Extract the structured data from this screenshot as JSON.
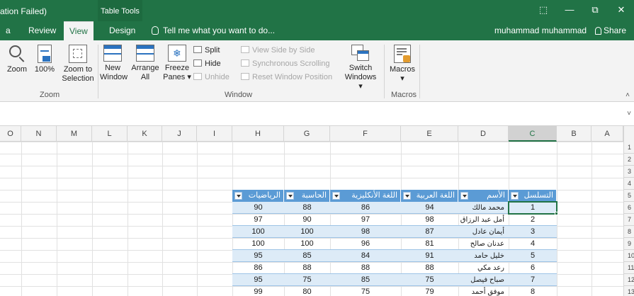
{
  "titlebar": {
    "window_title": "ation Failed)",
    "context_tab": "Table Tools",
    "buttons": {
      "restore_ribbon": "⬚",
      "minimize": "—",
      "maximize": "⧉",
      "close": "✕"
    }
  },
  "tabs": {
    "items": [
      {
        "label": "a"
      },
      {
        "label": "Review"
      },
      {
        "label": "View",
        "active": true
      },
      {
        "label": "Design"
      }
    ],
    "tell_me": "Tell me what you want to do...",
    "user": "muhammad muhammad",
    "share": "Share"
  },
  "ribbon": {
    "zoom_group": {
      "label": "Zoom",
      "zoom": "Zoom",
      "hundred": "100%",
      "zoom_to_selection_1": "Zoom to",
      "zoom_to_selection_2": "Selection"
    },
    "window_group": {
      "label": "Window",
      "new_window_1": "New",
      "new_window_2": "Window",
      "arrange_all_1": "Arrange",
      "arrange_all_2": "All",
      "freeze_panes_1": "Freeze",
      "freeze_panes_2": "Panes ▾",
      "split": "Split",
      "hide": "Hide",
      "unhide": "Unhide",
      "view_side_by_side": "View Side by Side",
      "synchronous_scrolling": "Synchronous Scrolling",
      "reset_window_position": "Reset Window Position",
      "switch_windows_1": "Switch",
      "switch_windows_2": "Windows ▾"
    },
    "macros_group": {
      "label": "Macros",
      "macros": "Macros",
      "macros_caret": "▾"
    },
    "collapse": "˄"
  },
  "formula_bar": {
    "expand": "˅"
  },
  "grid": {
    "columns": [
      "O",
      "N",
      "M",
      "L",
      "K",
      "J",
      "I",
      "H",
      "G",
      "F",
      "E",
      "D",
      "C",
      "B",
      "A"
    ],
    "selected_column": "C",
    "row_numbers": [
      "1",
      "2",
      "3",
      "4",
      "5",
      "6",
      "7",
      "8",
      "9",
      "10",
      "11",
      "12",
      "13"
    ]
  },
  "table": {
    "headers": [
      "الرياضيات",
      "الحاسبة",
      "اللغة الأنكليزية",
      "اللغة العربية",
      "الأسم",
      "التسلسل"
    ],
    "rows": [
      [
        "90",
        "88",
        "86",
        "94",
        "محمد مالك",
        "1"
      ],
      [
        "97",
        "90",
        "97",
        "98",
        "أمل عبد الرزاق",
        "2"
      ],
      [
        "100",
        "100",
        "98",
        "87",
        "أيمان عادل",
        "3"
      ],
      [
        "100",
        "100",
        "96",
        "81",
        "عدنان صالح",
        "4"
      ],
      [
        "95",
        "85",
        "84",
        "91",
        "خليل حامد",
        "5"
      ],
      [
        "86",
        "88",
        "88",
        "88",
        "رعد مكي",
        "6"
      ],
      [
        "95",
        "75",
        "85",
        "75",
        "صباح فيصل",
        "7"
      ],
      [
        "99",
        "80",
        "75",
        "79",
        "موفق أحمد",
        "8"
      ]
    ]
  },
  "colors": {
    "excel_green": "#217346",
    "table_header": "#5b9bd5",
    "band": "#ddebf7"
  }
}
